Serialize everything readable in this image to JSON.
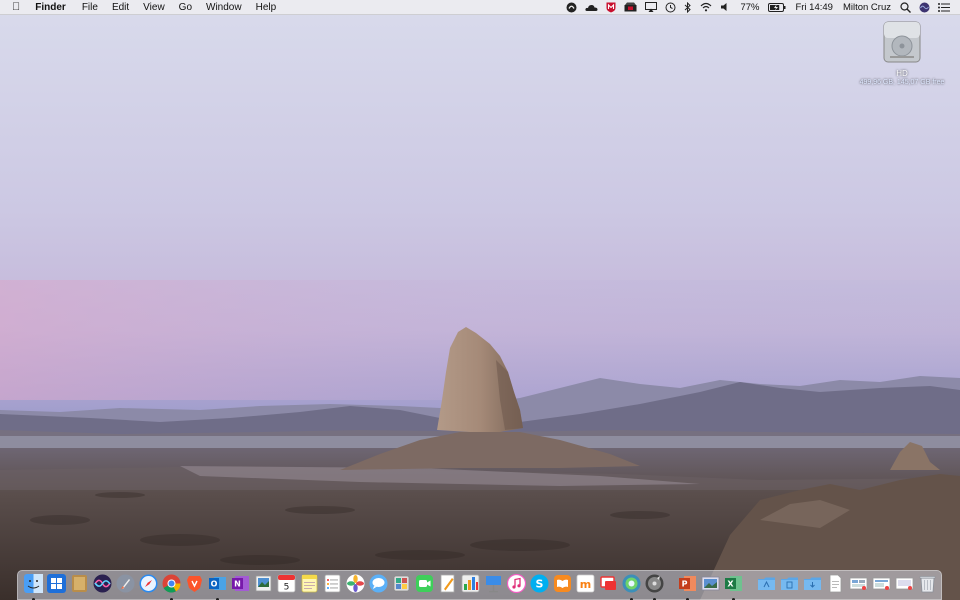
{
  "menubar": {
    "app_name": "Finder",
    "menus": [
      "File",
      "Edit",
      "View",
      "Go",
      "Window",
      "Help"
    ],
    "status_icons": [
      "creative-cloud-icon",
      "onedrive-icon",
      "mcafee-icon",
      "clipper-icon",
      "airplay-icon",
      "time-machine-icon",
      "bluetooth-icon",
      "wifi-icon",
      "volume-icon"
    ],
    "battery_percent": "77%",
    "battery_level": 0.77,
    "clock": "Fri 14:49",
    "user": "Milton Cruz"
  },
  "desktop": {
    "drive": {
      "name": "HD",
      "info": "499,96 GB, 145,07 GB free"
    }
  },
  "dock": {
    "apps": [
      {
        "name": "Finder",
        "icon": "finder-icon",
        "running": true
      },
      {
        "name": "Windows",
        "icon": "windows-icon",
        "running": false
      },
      {
        "name": "Notefile",
        "icon": "notebook-icon",
        "running": false
      },
      {
        "name": "Siri",
        "icon": "siri-icon",
        "running": false
      },
      {
        "name": "Launchpad",
        "icon": "launchpad-icon",
        "running": false
      },
      {
        "name": "Safari",
        "icon": "safari-icon",
        "running": false
      },
      {
        "name": "Chrome",
        "icon": "chrome-icon",
        "running": true
      },
      {
        "name": "Brave",
        "icon": "brave-icon",
        "running": false
      },
      {
        "name": "Outlook",
        "icon": "outlook-icon",
        "running": true
      },
      {
        "name": "OneNote",
        "icon": "onenote-icon",
        "running": false
      },
      {
        "name": "Preview",
        "icon": "preview-icon",
        "running": false
      },
      {
        "name": "Calendar",
        "icon": "calendar-icon",
        "running": false,
        "badge": "5"
      },
      {
        "name": "Notes",
        "icon": "notes-icon",
        "running": false
      },
      {
        "name": "Reminders",
        "icon": "reminders-icon",
        "running": false
      },
      {
        "name": "Photos",
        "icon": "photos-icon",
        "running": false
      },
      {
        "name": "Messages",
        "icon": "messages-icon",
        "running": false
      },
      {
        "name": "Photo Booth",
        "icon": "photo-booth-icon",
        "running": false
      },
      {
        "name": "FaceTime",
        "icon": "facetime-icon",
        "running": false
      },
      {
        "name": "Pages",
        "icon": "pages-icon",
        "running": false
      },
      {
        "name": "Numbers",
        "icon": "numbers-icon",
        "running": false
      },
      {
        "name": "Keynote",
        "icon": "keynote-icon",
        "running": false
      },
      {
        "name": "iTunes",
        "icon": "itunes-icon",
        "running": false
      },
      {
        "name": "Skype",
        "icon": "skype-icon",
        "running": false
      },
      {
        "name": "iBooks",
        "icon": "ibooks-icon",
        "running": false
      },
      {
        "name": "Moodle",
        "icon": "moodle-icon",
        "running": false
      },
      {
        "name": "Screen Sharing",
        "icon": "screen-sharing-icon",
        "running": false
      },
      {
        "name": "Network",
        "icon": "network-icon",
        "running": true
      },
      {
        "name": "Disk Utility",
        "icon": "disk-utility-icon",
        "running": true
      }
    ],
    "apps_2": [
      {
        "name": "PowerPoint",
        "icon": "powerpoint-icon",
        "running": true
      },
      {
        "name": "Photo Viewer",
        "icon": "photo-viewer-icon",
        "running": false
      },
      {
        "name": "Excel",
        "icon": "excel-icon",
        "running": true
      }
    ],
    "stacks": [
      {
        "name": "Applications",
        "icon": "folder-icon"
      },
      {
        "name": "Documents",
        "icon": "folder-icon"
      },
      {
        "name": "Downloads",
        "icon": "folder-icon"
      },
      {
        "name": "Document",
        "icon": "document-icon"
      },
      {
        "name": "Screenshot 1",
        "icon": "screenshot-icon"
      },
      {
        "name": "Screenshot 2",
        "icon": "screenshot-icon"
      },
      {
        "name": "Screenshot 3",
        "icon": "screenshot-icon"
      },
      {
        "name": "Trash",
        "icon": "trash-icon"
      }
    ]
  }
}
